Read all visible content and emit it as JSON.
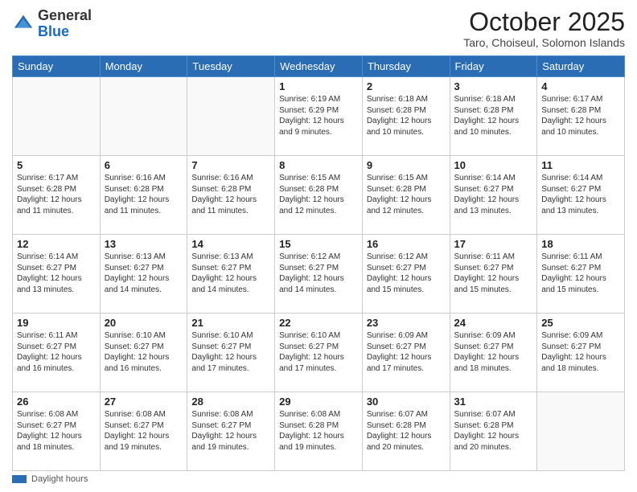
{
  "header": {
    "logo_general": "General",
    "logo_blue": "Blue",
    "month_title": "October 2025",
    "subtitle": "Taro, Choiseul, Solomon Islands"
  },
  "footer": {
    "label": "Daylight hours"
  },
  "days_of_week": [
    "Sunday",
    "Monday",
    "Tuesday",
    "Wednesday",
    "Thursday",
    "Friday",
    "Saturday"
  ],
  "weeks": [
    [
      {
        "day": "",
        "info": ""
      },
      {
        "day": "",
        "info": ""
      },
      {
        "day": "",
        "info": ""
      },
      {
        "day": "1",
        "info": "Sunrise: 6:19 AM\nSunset: 6:29 PM\nDaylight: 12 hours\nand 9 minutes."
      },
      {
        "day": "2",
        "info": "Sunrise: 6:18 AM\nSunset: 6:28 PM\nDaylight: 12 hours\nand 10 minutes."
      },
      {
        "day": "3",
        "info": "Sunrise: 6:18 AM\nSunset: 6:28 PM\nDaylight: 12 hours\nand 10 minutes."
      },
      {
        "day": "4",
        "info": "Sunrise: 6:17 AM\nSunset: 6:28 PM\nDaylight: 12 hours\nand 10 minutes."
      }
    ],
    [
      {
        "day": "5",
        "info": "Sunrise: 6:17 AM\nSunset: 6:28 PM\nDaylight: 12 hours\nand 11 minutes."
      },
      {
        "day": "6",
        "info": "Sunrise: 6:16 AM\nSunset: 6:28 PM\nDaylight: 12 hours\nand 11 minutes."
      },
      {
        "day": "7",
        "info": "Sunrise: 6:16 AM\nSunset: 6:28 PM\nDaylight: 12 hours\nand 11 minutes."
      },
      {
        "day": "8",
        "info": "Sunrise: 6:15 AM\nSunset: 6:28 PM\nDaylight: 12 hours\nand 12 minutes."
      },
      {
        "day": "9",
        "info": "Sunrise: 6:15 AM\nSunset: 6:28 PM\nDaylight: 12 hours\nand 12 minutes."
      },
      {
        "day": "10",
        "info": "Sunrise: 6:14 AM\nSunset: 6:27 PM\nDaylight: 12 hours\nand 13 minutes."
      },
      {
        "day": "11",
        "info": "Sunrise: 6:14 AM\nSunset: 6:27 PM\nDaylight: 12 hours\nand 13 minutes."
      }
    ],
    [
      {
        "day": "12",
        "info": "Sunrise: 6:14 AM\nSunset: 6:27 PM\nDaylight: 12 hours\nand 13 minutes."
      },
      {
        "day": "13",
        "info": "Sunrise: 6:13 AM\nSunset: 6:27 PM\nDaylight: 12 hours\nand 14 minutes."
      },
      {
        "day": "14",
        "info": "Sunrise: 6:13 AM\nSunset: 6:27 PM\nDaylight: 12 hours\nand 14 minutes."
      },
      {
        "day": "15",
        "info": "Sunrise: 6:12 AM\nSunset: 6:27 PM\nDaylight: 12 hours\nand 14 minutes."
      },
      {
        "day": "16",
        "info": "Sunrise: 6:12 AM\nSunset: 6:27 PM\nDaylight: 12 hours\nand 15 minutes."
      },
      {
        "day": "17",
        "info": "Sunrise: 6:11 AM\nSunset: 6:27 PM\nDaylight: 12 hours\nand 15 minutes."
      },
      {
        "day": "18",
        "info": "Sunrise: 6:11 AM\nSunset: 6:27 PM\nDaylight: 12 hours\nand 15 minutes."
      }
    ],
    [
      {
        "day": "19",
        "info": "Sunrise: 6:11 AM\nSunset: 6:27 PM\nDaylight: 12 hours\nand 16 minutes."
      },
      {
        "day": "20",
        "info": "Sunrise: 6:10 AM\nSunset: 6:27 PM\nDaylight: 12 hours\nand 16 minutes."
      },
      {
        "day": "21",
        "info": "Sunrise: 6:10 AM\nSunset: 6:27 PM\nDaylight: 12 hours\nand 17 minutes."
      },
      {
        "day": "22",
        "info": "Sunrise: 6:10 AM\nSunset: 6:27 PM\nDaylight: 12 hours\nand 17 minutes."
      },
      {
        "day": "23",
        "info": "Sunrise: 6:09 AM\nSunset: 6:27 PM\nDaylight: 12 hours\nand 17 minutes."
      },
      {
        "day": "24",
        "info": "Sunrise: 6:09 AM\nSunset: 6:27 PM\nDaylight: 12 hours\nand 18 minutes."
      },
      {
        "day": "25",
        "info": "Sunrise: 6:09 AM\nSunset: 6:27 PM\nDaylight: 12 hours\nand 18 minutes."
      }
    ],
    [
      {
        "day": "26",
        "info": "Sunrise: 6:08 AM\nSunset: 6:27 PM\nDaylight: 12 hours\nand 18 minutes."
      },
      {
        "day": "27",
        "info": "Sunrise: 6:08 AM\nSunset: 6:27 PM\nDaylight: 12 hours\nand 19 minutes."
      },
      {
        "day": "28",
        "info": "Sunrise: 6:08 AM\nSunset: 6:27 PM\nDaylight: 12 hours\nand 19 minutes."
      },
      {
        "day": "29",
        "info": "Sunrise: 6:08 AM\nSunset: 6:28 PM\nDaylight: 12 hours\nand 19 minutes."
      },
      {
        "day": "30",
        "info": "Sunrise: 6:07 AM\nSunset: 6:28 PM\nDaylight: 12 hours\nand 20 minutes."
      },
      {
        "day": "31",
        "info": "Sunrise: 6:07 AM\nSunset: 6:28 PM\nDaylight: 12 hours\nand 20 minutes."
      },
      {
        "day": "",
        "info": ""
      }
    ]
  ]
}
